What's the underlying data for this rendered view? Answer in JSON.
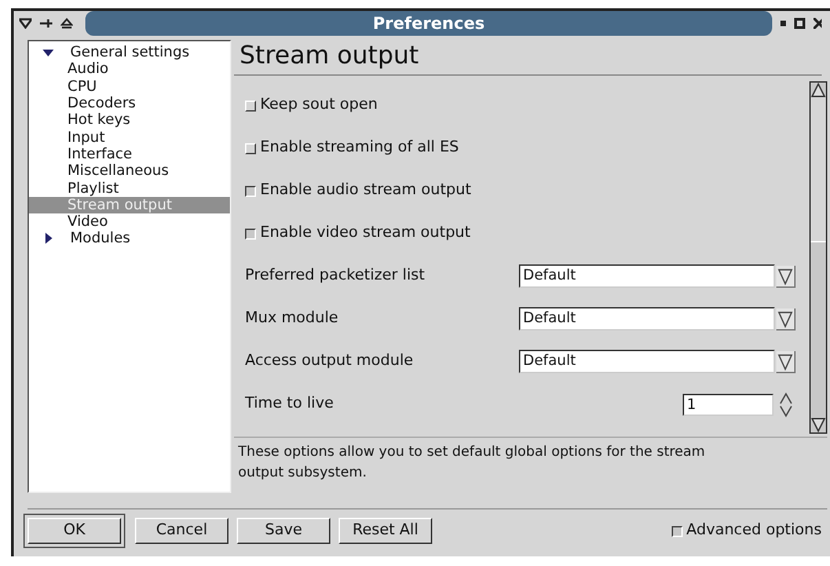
{
  "window": {
    "title": "Preferences"
  },
  "tree": [
    {
      "label": "General settings",
      "expanded": true,
      "selected": false,
      "children": [
        {
          "label": "Audio",
          "selected": false
        },
        {
          "label": "CPU",
          "selected": false
        },
        {
          "label": "Decoders",
          "selected": false
        },
        {
          "label": "Hot keys",
          "selected": false
        },
        {
          "label": "Input",
          "selected": false
        },
        {
          "label": "Interface",
          "selected": false
        },
        {
          "label": "Miscellaneous",
          "selected": false
        },
        {
          "label": "Playlist",
          "selected": false
        },
        {
          "label": "Stream output",
          "selected": true
        },
        {
          "label": "Video",
          "selected": false
        }
      ]
    },
    {
      "label": "Modules",
      "expanded": false,
      "selected": false
    }
  ],
  "panel": {
    "title": "Stream output",
    "options": [
      {
        "kind": "checkbox",
        "label": "Keep sout open",
        "checked": false
      },
      {
        "kind": "checkbox",
        "label": "Enable streaming of all ES",
        "checked": false
      },
      {
        "kind": "checkbox",
        "label": "Enable audio stream output",
        "checked": true
      },
      {
        "kind": "checkbox",
        "label": "Enable video stream output",
        "checked": true
      },
      {
        "kind": "dropdown",
        "label": "Preferred packetizer list",
        "value": "Default"
      },
      {
        "kind": "dropdown",
        "label": "Mux module",
        "value": "Default"
      },
      {
        "kind": "dropdown",
        "label": "Access output module",
        "value": "Default"
      },
      {
        "kind": "spin",
        "label": "Time to live",
        "value": "1"
      }
    ],
    "description": "These options allow you to set default global options for the stream output subsystem."
  },
  "buttons": [
    "OK",
    "Cancel",
    "Save",
    "Reset All"
  ],
  "advanced": {
    "label": "Advanced options",
    "checked": true
  }
}
